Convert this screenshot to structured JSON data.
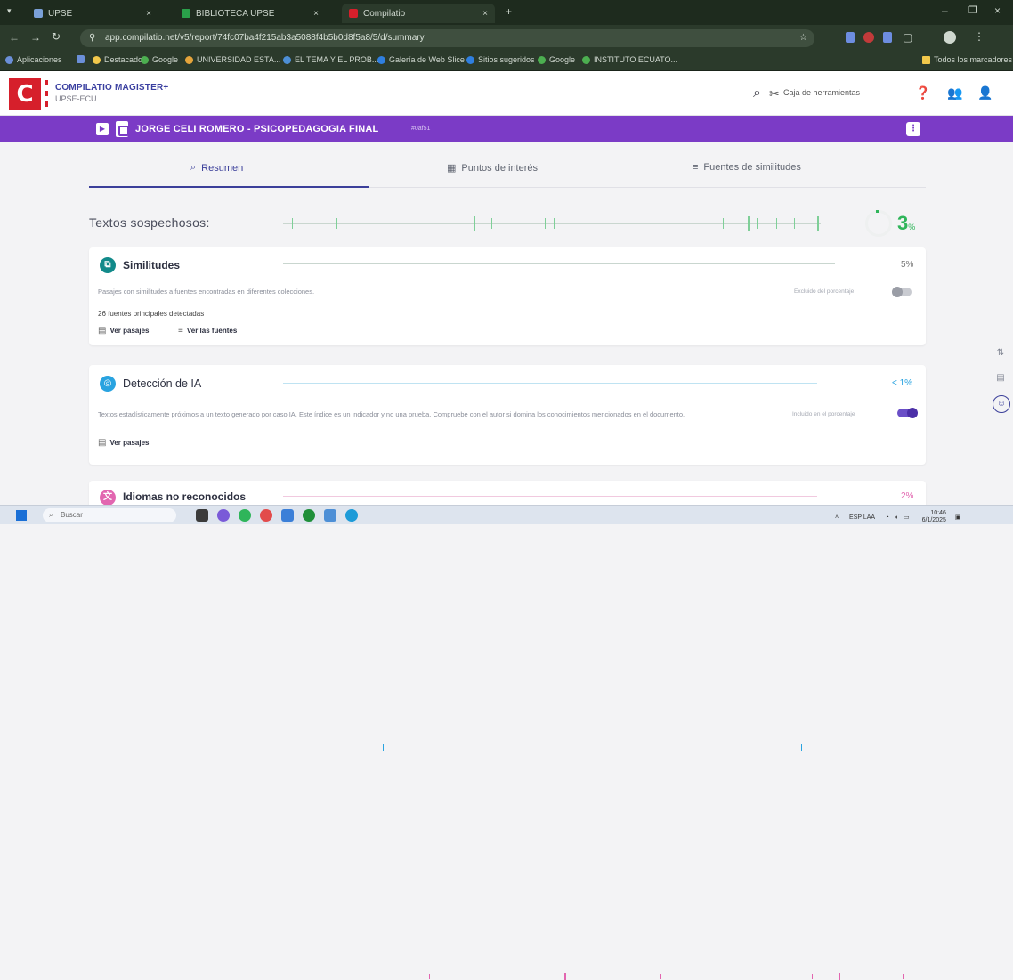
{
  "browser": {
    "tabs": [
      {
        "label": "UPSE",
        "color": "#7aa0d8"
      },
      {
        "label": "BIBLIOTECA UPSE",
        "color": "#2aa04a"
      },
      {
        "label": "Compilatio",
        "color": "#d61f2b"
      }
    ],
    "url": "app.compilatio.net/v5/report/74fc07ba4f215ab3a5088f4b5b0d8f5a8/5/d/summary",
    "bookmarks": [
      {
        "label": "Aplicaciones",
        "color": "#6b8fd8"
      },
      {
        "label": "",
        "color": "#6b8fd8"
      },
      {
        "label": "Destacado",
        "color": "#f2c84b"
      },
      {
        "label": "Google",
        "color": "#4caf50"
      },
      {
        "label": "UNIVERSIDAD ESTA...",
        "color": "#e5a43b"
      },
      {
        "label": "EL TEMA Y EL PROB...",
        "color": "#4d8fd6"
      },
      {
        "label": "Galería de Web Slice",
        "color": "#2f7fe0"
      },
      {
        "label": "Sitios sugeridos",
        "color": "#2f7fe0"
      },
      {
        "label": "Google",
        "color": "#4caf50"
      },
      {
        "label": "INSTITUTO ECUATO...",
        "color": "#4caf50"
      }
    ],
    "all_bookmarks": "Todos los marcadores"
  },
  "app": {
    "brand": "COMPILATIO MAGISTER+",
    "brand_sub": "UPSE-ECU",
    "toolbox": "Caja de herramientas",
    "doc_title": "JORGE CELI ROMERO - PSICOPEDAGOGIA FINAL",
    "doc_badge": "#0af51"
  },
  "tabs": {
    "summary": "Resumen",
    "points": "Puntos de interés",
    "sources": "Fuentes de similitudes"
  },
  "suspicious": {
    "label": "Textos sospechosos:",
    "percent": "3",
    "unit": "%"
  },
  "cards": {
    "similarities": {
      "title": "Similitudes",
      "percent": "5%",
      "desc": "Pasajes con similitudes a fuentes encontradas en diferentes colecciones.",
      "toggle_label": "Excluido del porcentaje",
      "sources_count": "26 fuentes principales detectadas",
      "link_passages": "Ver pasajes",
      "link_sources": "Ver las fuentes"
    },
    "ai": {
      "title": "Detección de IA",
      "percent": "< 1%",
      "desc": "Textos estadísticamente próximos a un texto generado por caso IA. Este índice es un indicador y no una prueba. Compruebe con el autor si domina los conocimientos mencionados en el documento.",
      "toggle_label": "Incluido en el porcentaje",
      "link_passages": "Ver pasajes"
    },
    "languages": {
      "title": "Idiomas no reconocidos",
      "percent": "2%"
    }
  },
  "taskbar": {
    "search": "Buscar",
    "lang": "ESP LAA",
    "time": "10:46",
    "date": "6/1/2025"
  },
  "colors": {
    "purple": "#7b3bc6",
    "green": "#2fb55a",
    "accent": "#3b3f9a"
  }
}
